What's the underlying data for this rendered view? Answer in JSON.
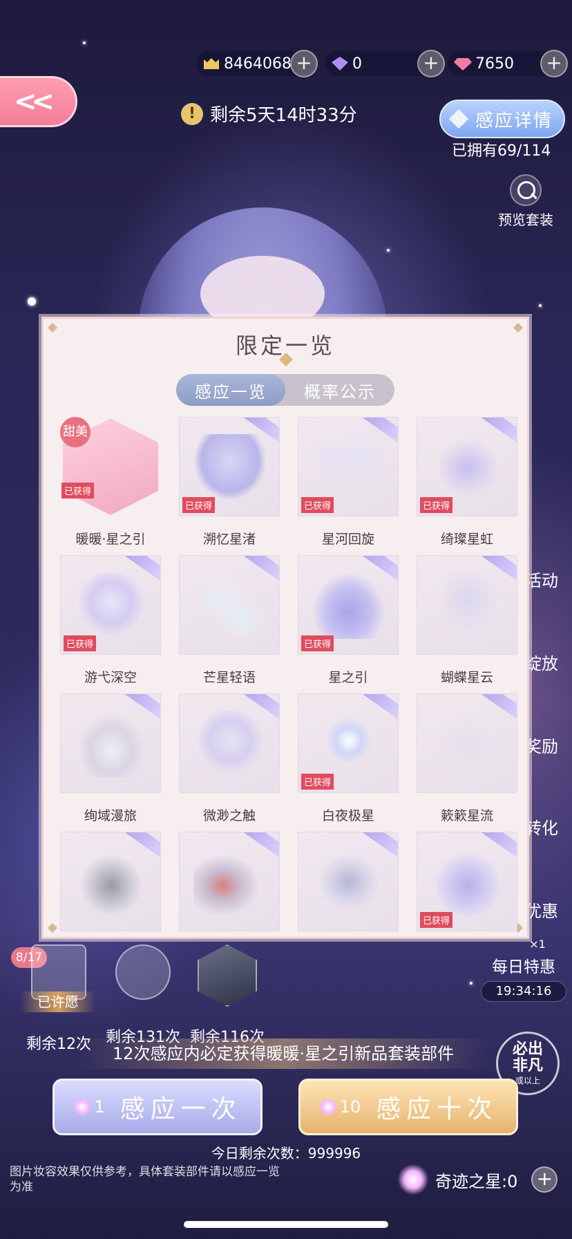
{
  "currencies": [
    {
      "icon": "gold-coin-icon",
      "value": "8464068"
    },
    {
      "icon": "purple-crystal-icon",
      "value": "0"
    },
    {
      "icon": "pink-diamond-icon",
      "value": "7650"
    }
  ],
  "timer": {
    "text": "剩余5天14时33分"
  },
  "details": {
    "button_label": "感应详情",
    "owned": "已拥有69/114"
  },
  "preview": {
    "label": "预览套装"
  },
  "side_labels": [
    "活动",
    "绽放",
    "奖励",
    "转化",
    "优惠"
  ],
  "modal": {
    "title": "限定一览",
    "tabs": [
      {
        "label": "感应一览",
        "active": true
      },
      {
        "label": "概率公示",
        "active": false
      }
    ],
    "obtained_label": "已获得",
    "items": [
      {
        "name": "暖暖·星之引",
        "obtained": true,
        "tag": "甜美"
      },
      {
        "name": "溯忆星渚",
        "obtained": true
      },
      {
        "name": "星河回旋",
        "obtained": true
      },
      {
        "name": "绮璨星虹",
        "obtained": true
      },
      {
        "name": "游弋深空",
        "obtained": true
      },
      {
        "name": "芒星轻语",
        "obtained": false
      },
      {
        "name": "星之引",
        "obtained": true
      },
      {
        "name": "蝴蝶星云",
        "obtained": false
      },
      {
        "name": "绚域漫旅",
        "obtained": false
      },
      {
        "name": "微渺之触",
        "obtained": false
      },
      {
        "name": "白夜极星",
        "obtained": true
      },
      {
        "name": "簌簌星流",
        "obtained": false
      },
      {
        "name": "",
        "obtained": false
      },
      {
        "name": "",
        "obtained": false
      },
      {
        "name": "",
        "obtained": false
      },
      {
        "name": "",
        "obtained": true
      }
    ]
  },
  "prizes": [
    {
      "text": "剩余12次",
      "badge": "8/17",
      "wish": "已许愿"
    },
    {
      "text": "剩余131次"
    },
    {
      "text": "剩余116次"
    }
  ],
  "daily": {
    "label": "每日特惠",
    "time": "19:34:16",
    "count": "×1"
  },
  "guarantee_text": "12次感应内必定获得暖暖·星之引新品套装部件",
  "pull_one": {
    "count": "1",
    "label": "感应一次"
  },
  "pull_ten": {
    "count": "10",
    "label": "感应十次"
  },
  "seal": {
    "line1": "必出",
    "line2": "非凡",
    "line3": "或以上"
  },
  "remaining_today": "今日剩余次数：999996",
  "disclaimer": "图片妆容效果仅供参考，具体套装部件请以感应一览为准",
  "miracle_star": "奇迹之星:0",
  "colors": {
    "obtained_badge": "#e04b5e",
    "back_button": "#f27e98",
    "details_button": "#7fa5ef"
  }
}
